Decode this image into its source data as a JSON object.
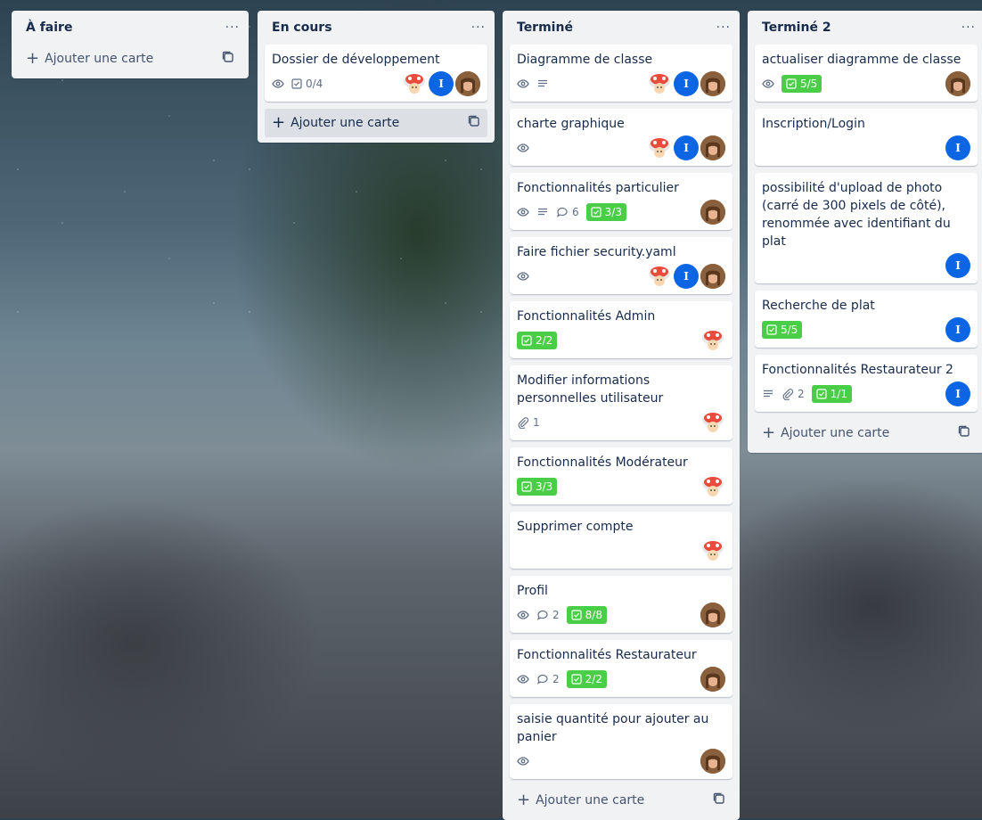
{
  "lists": [
    {
      "title": "À faire",
      "add_label": "Ajouter une carte",
      "cards": []
    },
    {
      "title": "En cours",
      "add_label": "Ajouter une carte",
      "cards": [
        {
          "title": "Dossier de développement",
          "checklist": "0/4"
        }
      ]
    },
    {
      "title": "Terminé",
      "add_label": "Ajouter une carte",
      "cards": [
        {
          "title": "Diagramme de classe"
        },
        {
          "title": "charte graphique"
        },
        {
          "title": "Fonctionnalités particulier",
          "comments": "6",
          "checklist": "3/3"
        },
        {
          "title": "Faire fichier security.yaml"
        },
        {
          "title": "Fonctionnalités Admin",
          "checklist": "2/2"
        },
        {
          "title": "Modifier informations personnelles utilisateur",
          "attachments": "1"
        },
        {
          "title": "Fonctionnalités Modérateur",
          "checklist": "3/3"
        },
        {
          "title": "Supprimer compte"
        },
        {
          "title": "Profil",
          "comments": "2",
          "checklist": "8/8"
        },
        {
          "title": "Fonctionnalités Restaurateur",
          "comments": "2",
          "checklist": "2/2"
        },
        {
          "title": "saisie quantité pour ajouter au panier"
        }
      ]
    },
    {
      "title": "Terminé 2",
      "add_label": "Ajouter une carte",
      "cards": [
        {
          "title": "actualiser diagramme de classe",
          "checklist": "5/5"
        },
        {
          "title": "Inscription/Login"
        },
        {
          "title": "possibilité d'upload de photo (carré de 300 pixels de côté), renommée avec identifiant du plat"
        },
        {
          "title": "Recherche de plat",
          "checklist": "5/5"
        },
        {
          "title": "Fonctionnalités Restaurateur 2",
          "attachments": "2",
          "checklist": "1/1"
        }
      ]
    }
  ],
  "member_initial": "I",
  "colors": {
    "list_bg": "#f1f2f4",
    "complete_badge": "#4bce47",
    "member_blue": "#0c66e4"
  }
}
